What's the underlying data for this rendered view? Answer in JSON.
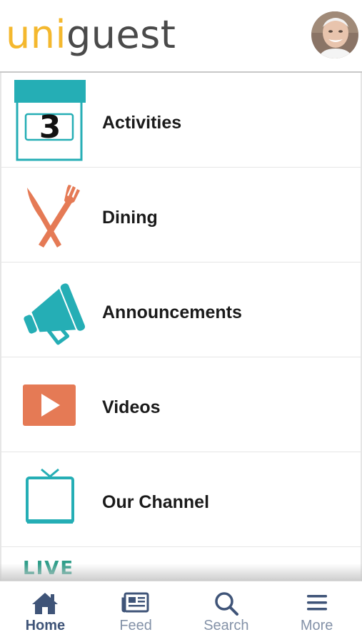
{
  "header": {
    "logo_part1": "uni",
    "logo_part2": "guest",
    "avatar": "user-avatar"
  },
  "menu": {
    "items": [
      {
        "label": "Activities",
        "icon": "calendar-icon",
        "icon_text": "3"
      },
      {
        "label": "Dining",
        "icon": "fork-knife-icon"
      },
      {
        "label": "Announcements",
        "icon": "megaphone-icon"
      },
      {
        "label": "Videos",
        "icon": "play-icon"
      },
      {
        "label": "Our Channel",
        "icon": "tv-icon"
      },
      {
        "label": "",
        "icon": "live-icon",
        "icon_text": "LIVE"
      }
    ]
  },
  "tabs": [
    {
      "label": "Home",
      "icon": "home-icon",
      "active": true
    },
    {
      "label": "Feed",
      "icon": "newspaper-icon",
      "active": false
    },
    {
      "label": "Search",
      "icon": "search-icon",
      "active": false
    },
    {
      "label": "More",
      "icon": "menu-icon",
      "active": false
    }
  ],
  "colors": {
    "teal": "#25aeb5",
    "orange": "#e57a55",
    "yellow": "#f4b82e",
    "navy": "#3f5478",
    "tab_inactive": "#8492a8"
  }
}
